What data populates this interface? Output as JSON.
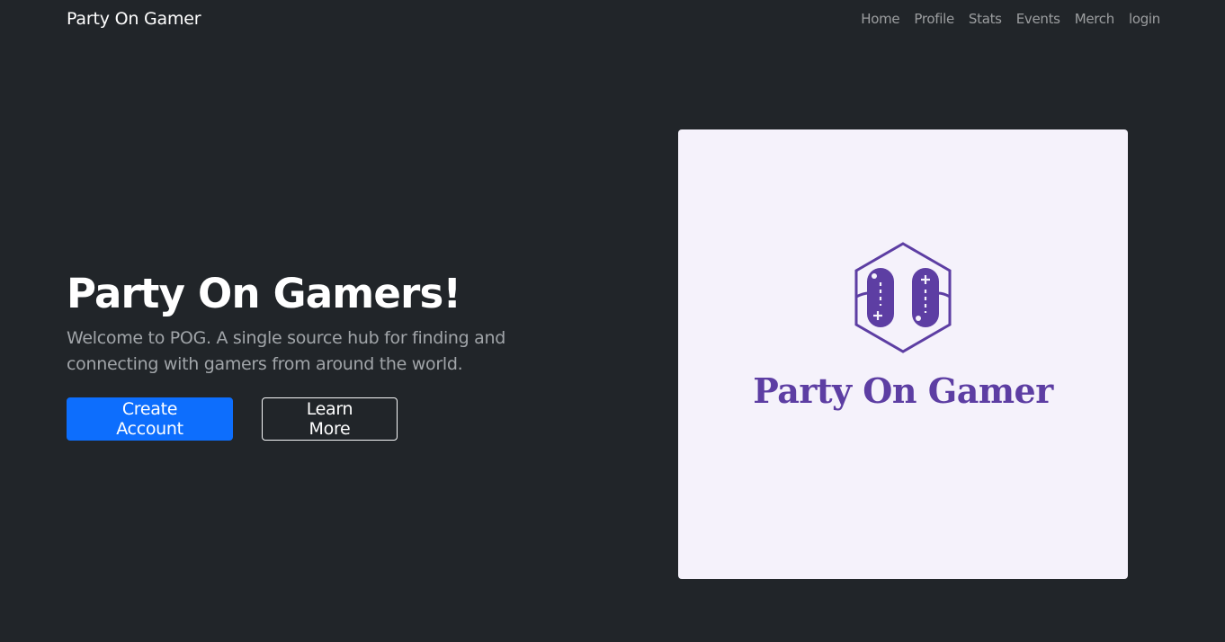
{
  "navbar": {
    "brand": "Party On Gamer",
    "links": [
      "Home",
      "Profile",
      "Stats",
      "Events",
      "Merch",
      "login"
    ]
  },
  "hero": {
    "title": "Party On Gamers!",
    "lead": "Welcome to POG. A single source hub for finding and connecting with gamers from around the world.",
    "primary_button": "Create Account",
    "secondary_button": "Learn More"
  },
  "logo": {
    "text": "Party On Gamer",
    "icon": "gamepad-hexagon-icon",
    "color": "#5d3ea3"
  },
  "colors": {
    "background": "#212529",
    "primary": "#0d6efd",
    "logo_card": "#f5f2fb"
  }
}
